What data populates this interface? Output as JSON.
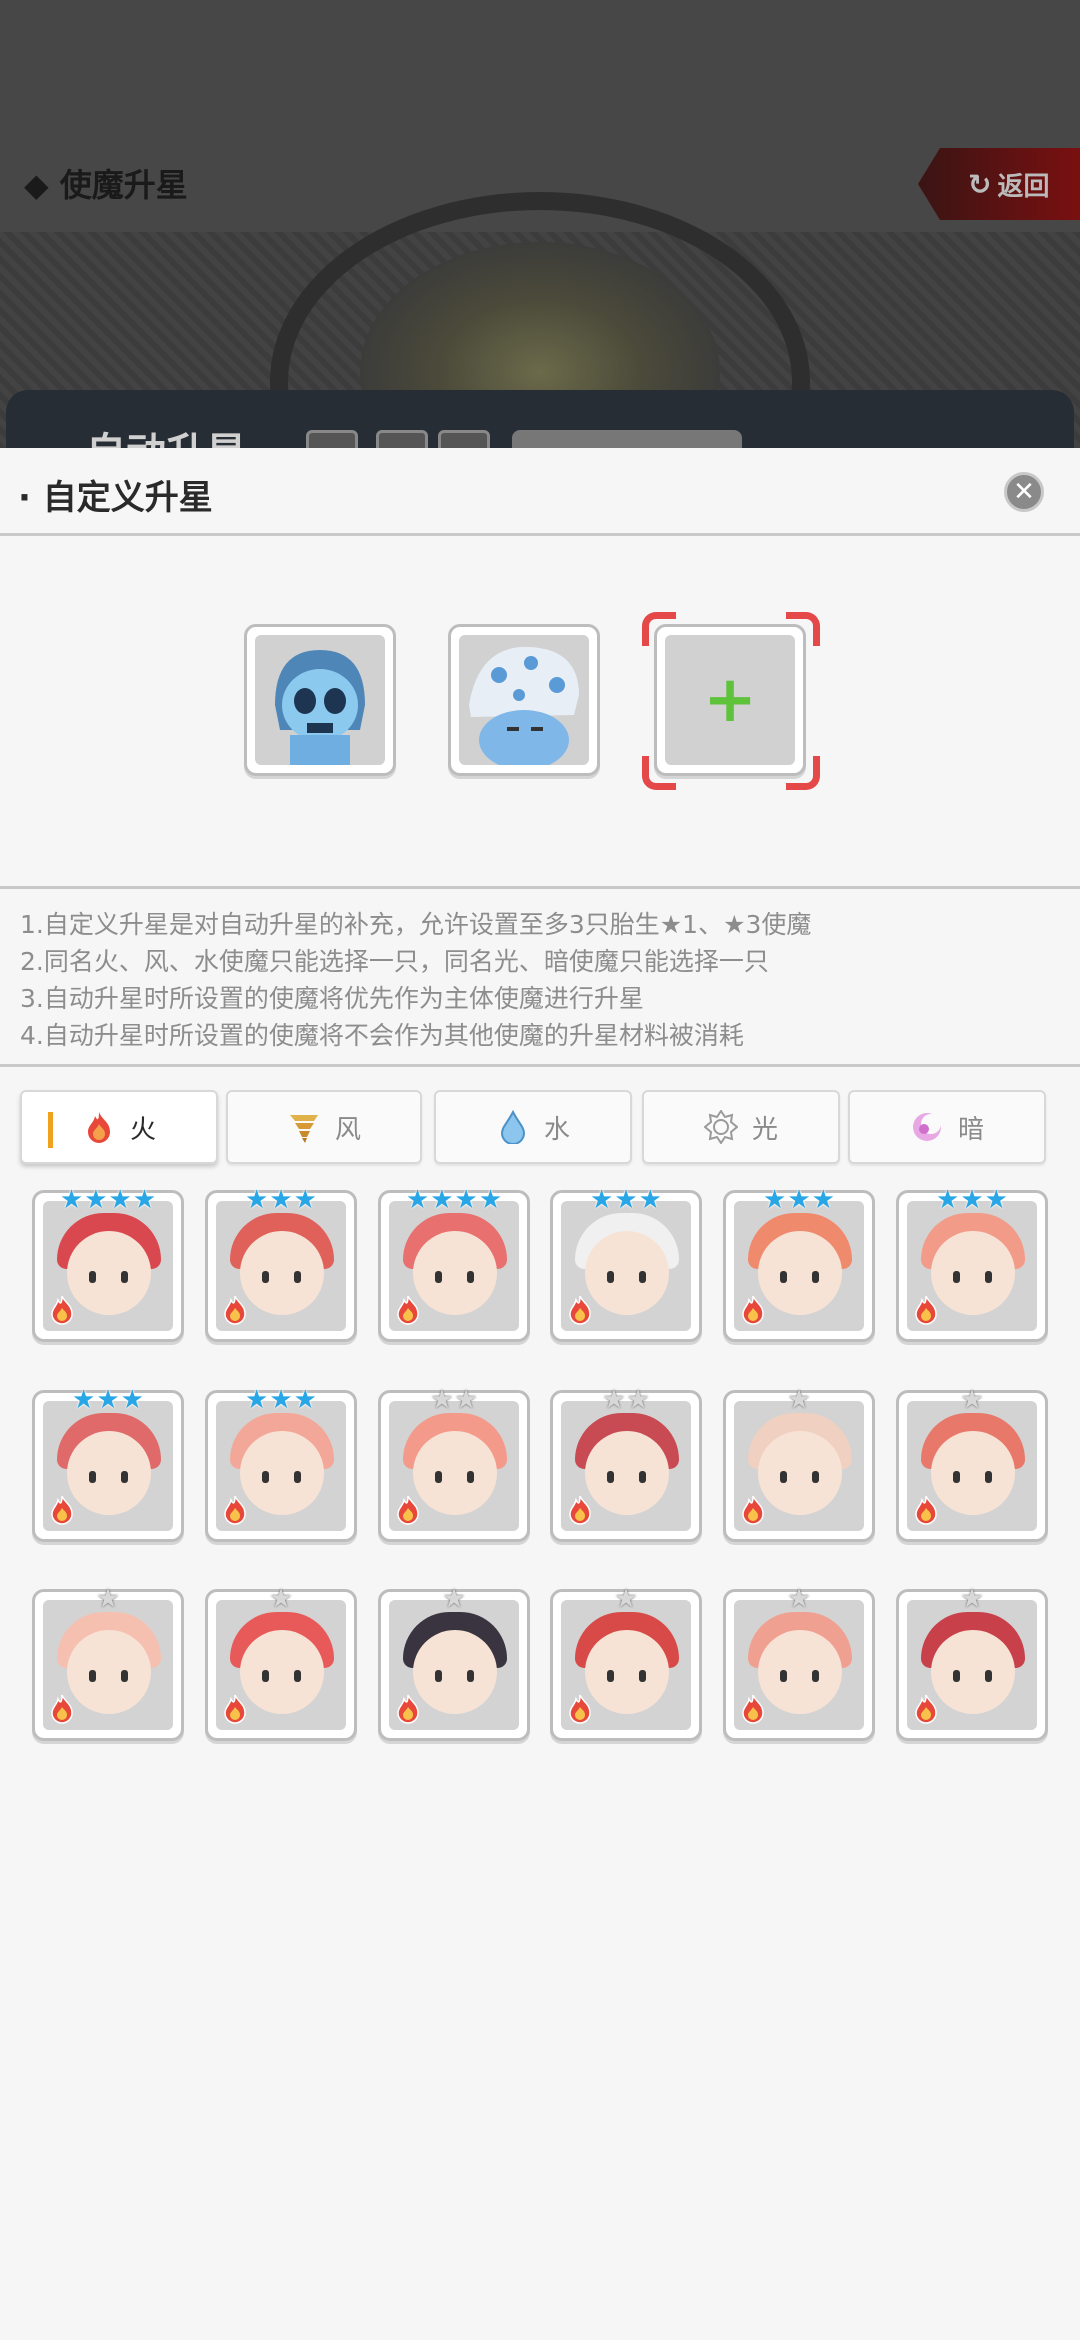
{
  "background": {
    "title": "◆ 使魔升星",
    "back_label": "返回",
    "panel_title": "自动升星"
  },
  "modal": {
    "title": "· 自定义升星",
    "close_icon": "close-icon",
    "selected_slots": [
      {
        "name": "skull-hood-familiar",
        "color": "#6fb6e8"
      },
      {
        "name": "polka-turban-familiar",
        "color": "#9cc6ea"
      },
      {
        "name": "empty-add-slot",
        "plus": "+"
      }
    ],
    "rules": [
      "1.自定义升星是对自动升星的补充，允许设置至多3只胎生★1、★3使魔",
      "2.同名火、风、水使魔只能选择一只，同名光、暗使魔只能选择一只",
      "3.自动升星时所设置的使魔将优先作为主体使魔进行升星",
      "4.自动升星时所设置的使魔将不会作为其他使魔的升星材料被消耗"
    ],
    "tabs": [
      {
        "label": "火",
        "icon": "fire-icon",
        "active": true
      },
      {
        "label": "风",
        "icon": "tornado-icon",
        "active": false
      },
      {
        "label": "水",
        "icon": "water-drop-icon",
        "active": false
      },
      {
        "label": "光",
        "icon": "sun-icon",
        "active": false
      },
      {
        "label": "暗",
        "icon": "moon-icon",
        "active": false
      }
    ],
    "familiars": [
      {
        "stars": 4,
        "star_type": "blue",
        "color": "#d9484f"
      },
      {
        "stars": 3,
        "star_type": "blue",
        "color": "#e0605a"
      },
      {
        "stars": 4,
        "star_type": "blue",
        "color": "#e8706e"
      },
      {
        "stars": 3,
        "star_type": "blue",
        "color": "#f0f0f0"
      },
      {
        "stars": 3,
        "star_type": "blue",
        "color": "#f08a6c"
      },
      {
        "stars": 3,
        "star_type": "blue",
        "color": "#f29b88"
      },
      {
        "stars": 3,
        "star_type": "blue",
        "color": "#e06a6a"
      },
      {
        "stars": 3,
        "star_type": "blue",
        "color": "#f3a798"
      },
      {
        "stars": 2,
        "star_type": "silver",
        "color": "#f39a8a"
      },
      {
        "stars": 2,
        "star_type": "silver",
        "color": "#c84a52"
      },
      {
        "stars": 1,
        "star_type": "silver",
        "color": "#f0d0c0"
      },
      {
        "stars": 1,
        "star_type": "silver",
        "color": "#e8786a"
      },
      {
        "stars": 1,
        "star_type": "silver",
        "color": "#f6c0b0"
      },
      {
        "stars": 1,
        "star_type": "silver",
        "color": "#e85a5a"
      },
      {
        "stars": 1,
        "star_type": "silver",
        "color": "#3a3340"
      },
      {
        "stars": 1,
        "star_type": "silver",
        "color": "#d84a48"
      },
      {
        "stars": 1,
        "star_type": "silver",
        "color": "#f0a090"
      },
      {
        "stars": 1,
        "star_type": "silver",
        "color": "#c8404a"
      }
    ],
    "element_badge": "fire-icon"
  },
  "colors": {
    "accent_tab_bar": "#f0a21d",
    "plus_green": "#5fc23b",
    "bracket_red": "#e44848",
    "star_blue": "#29a6e6"
  }
}
